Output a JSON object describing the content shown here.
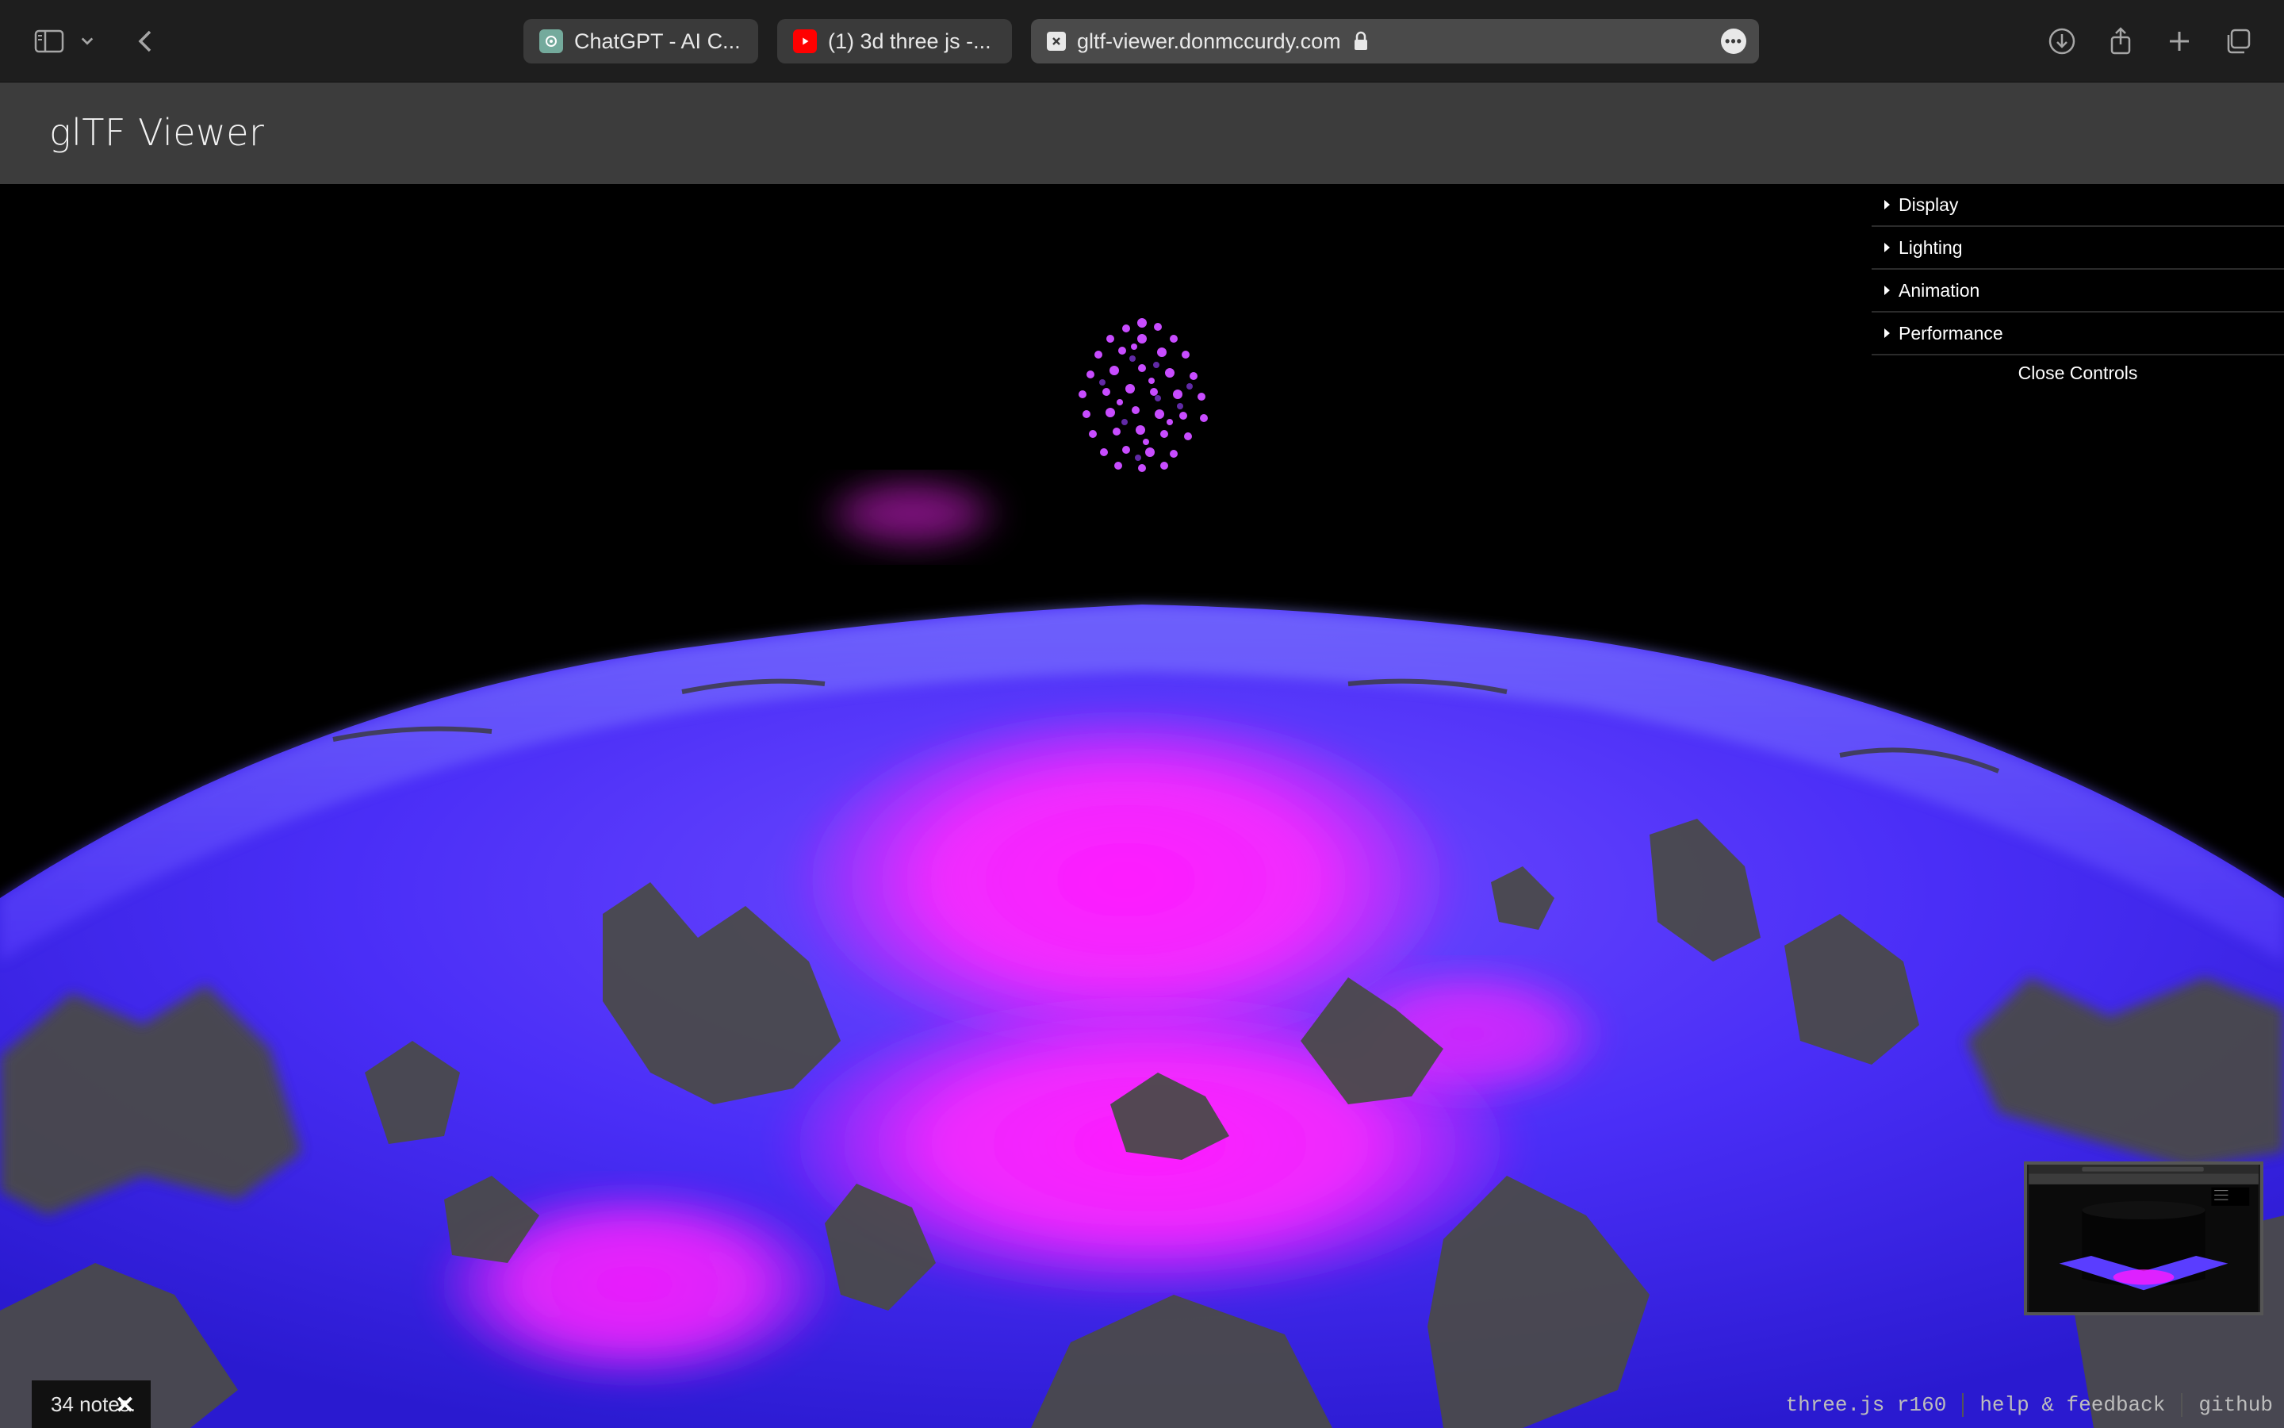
{
  "browser": {
    "tabs": [
      {
        "label": "ChatGPT - AI C...",
        "favicon": "chatgpt-icon",
        "color": "#74aa9c"
      },
      {
        "label": "(1) 3d three js -...",
        "favicon": "youtube-icon",
        "color": "#ff0000"
      },
      {
        "label": "gltf-viewer.donmccurdy.com",
        "favicon": "close-tab-icon",
        "active": true
      }
    ]
  },
  "app": {
    "title": "glTF Viewer"
  },
  "controls": {
    "folders": [
      {
        "label": "Display"
      },
      {
        "label": "Lighting"
      },
      {
        "label": "Animation"
      },
      {
        "label": "Performance"
      }
    ],
    "close_label": "Close Controls"
  },
  "notes": {
    "label": "34 notes.",
    "close": "✕"
  },
  "footer": {
    "version": "three.js r160",
    "help": "help & feedback",
    "github": "github"
  },
  "colors": {
    "accent_pink": "#ff1aff",
    "accent_blue": "#5a33ff",
    "terrain_gray": "#4a4a4a"
  }
}
